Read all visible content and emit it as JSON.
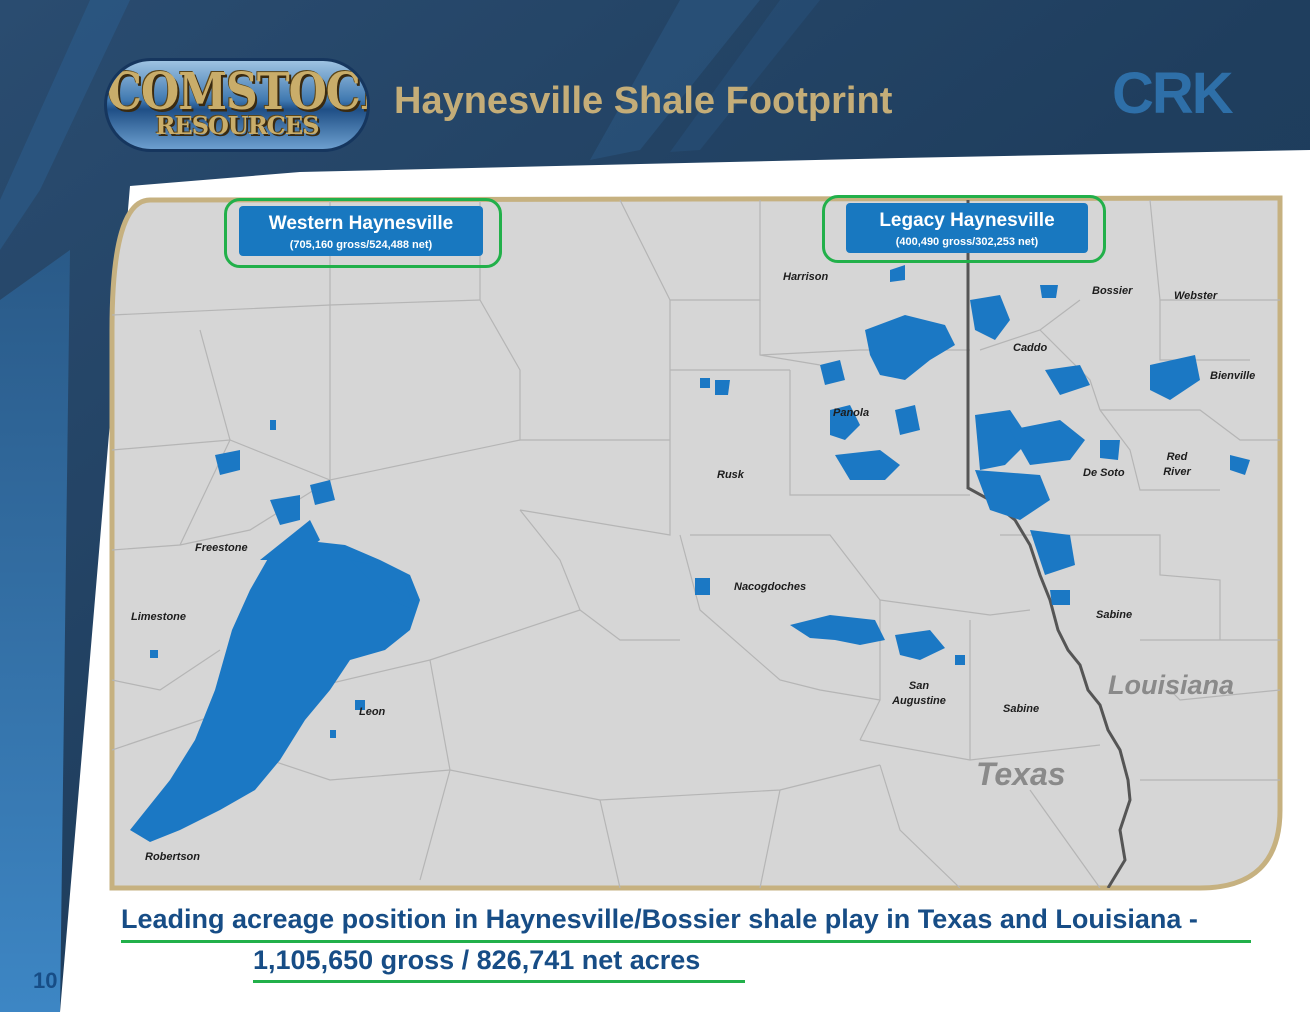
{
  "header": {
    "logo_top": "COMSTOCK",
    "logo_bottom": "RESOURCES",
    "title": "Haynesville Shale Footprint",
    "ticker": "CRK"
  },
  "map": {
    "regions": [
      {
        "name": "Western Haynesville",
        "stats": "(705,160 gross/524,488 net)"
      },
      {
        "name": "Legacy Haynesville",
        "stats": "(400,490 gross/302,253 net)"
      }
    ],
    "counties": [
      "Harrison",
      "Bossier",
      "Webster",
      "Caddo",
      "Bienville",
      "Panola",
      "Red River",
      "De Soto",
      "Rusk",
      "Freestone",
      "Limestone",
      "Nacogdoches",
      "Sabine",
      "San Augustine",
      "Sabine",
      "Leon",
      "Robertson"
    ],
    "states": [
      "Louisiana",
      "Texas"
    ]
  },
  "footer": {
    "line1": "Leading acreage position in Haynesville/Bossier shale play in Texas and Louisiana -",
    "line2": "1,105,650 gross / 826,741 net acres",
    "page": "10"
  },
  "colors": {
    "acreage": "#1b78c4",
    "header_bg": "#1f3f5f",
    "title": "#c4ad78",
    "footer_text": "#174d86",
    "highlight_ring": "#22b04a",
    "frame": "#c6b180"
  }
}
